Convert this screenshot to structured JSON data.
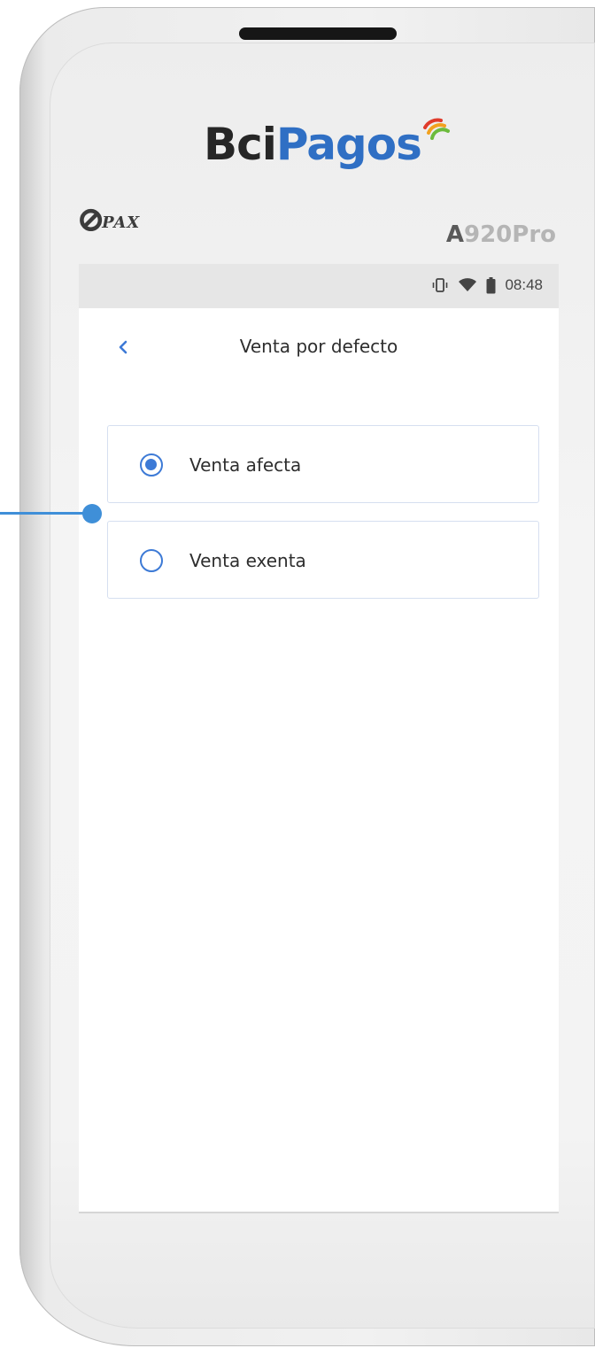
{
  "device": {
    "brand_bci": "Bci",
    "brand_pagos": "Pagos",
    "maker_logo_text": "PAX",
    "model_prefix": "A",
    "model_suffix": "920Pro"
  },
  "status_bar": {
    "time": "08:48",
    "icons": [
      "vibrate-icon",
      "wifi-icon",
      "battery-icon"
    ]
  },
  "header": {
    "title": "Venta por defecto",
    "back_icon": "chevron-left-icon"
  },
  "options": [
    {
      "label": "Venta afecta",
      "selected": true
    },
    {
      "label": "Venta exenta",
      "selected": false
    }
  ],
  "colors": {
    "accent": "#3d7ad6",
    "brand_blue": "#2f6fc4",
    "annotation": "#3f8fd8",
    "status_bar_bg": "#e6e6e6"
  }
}
